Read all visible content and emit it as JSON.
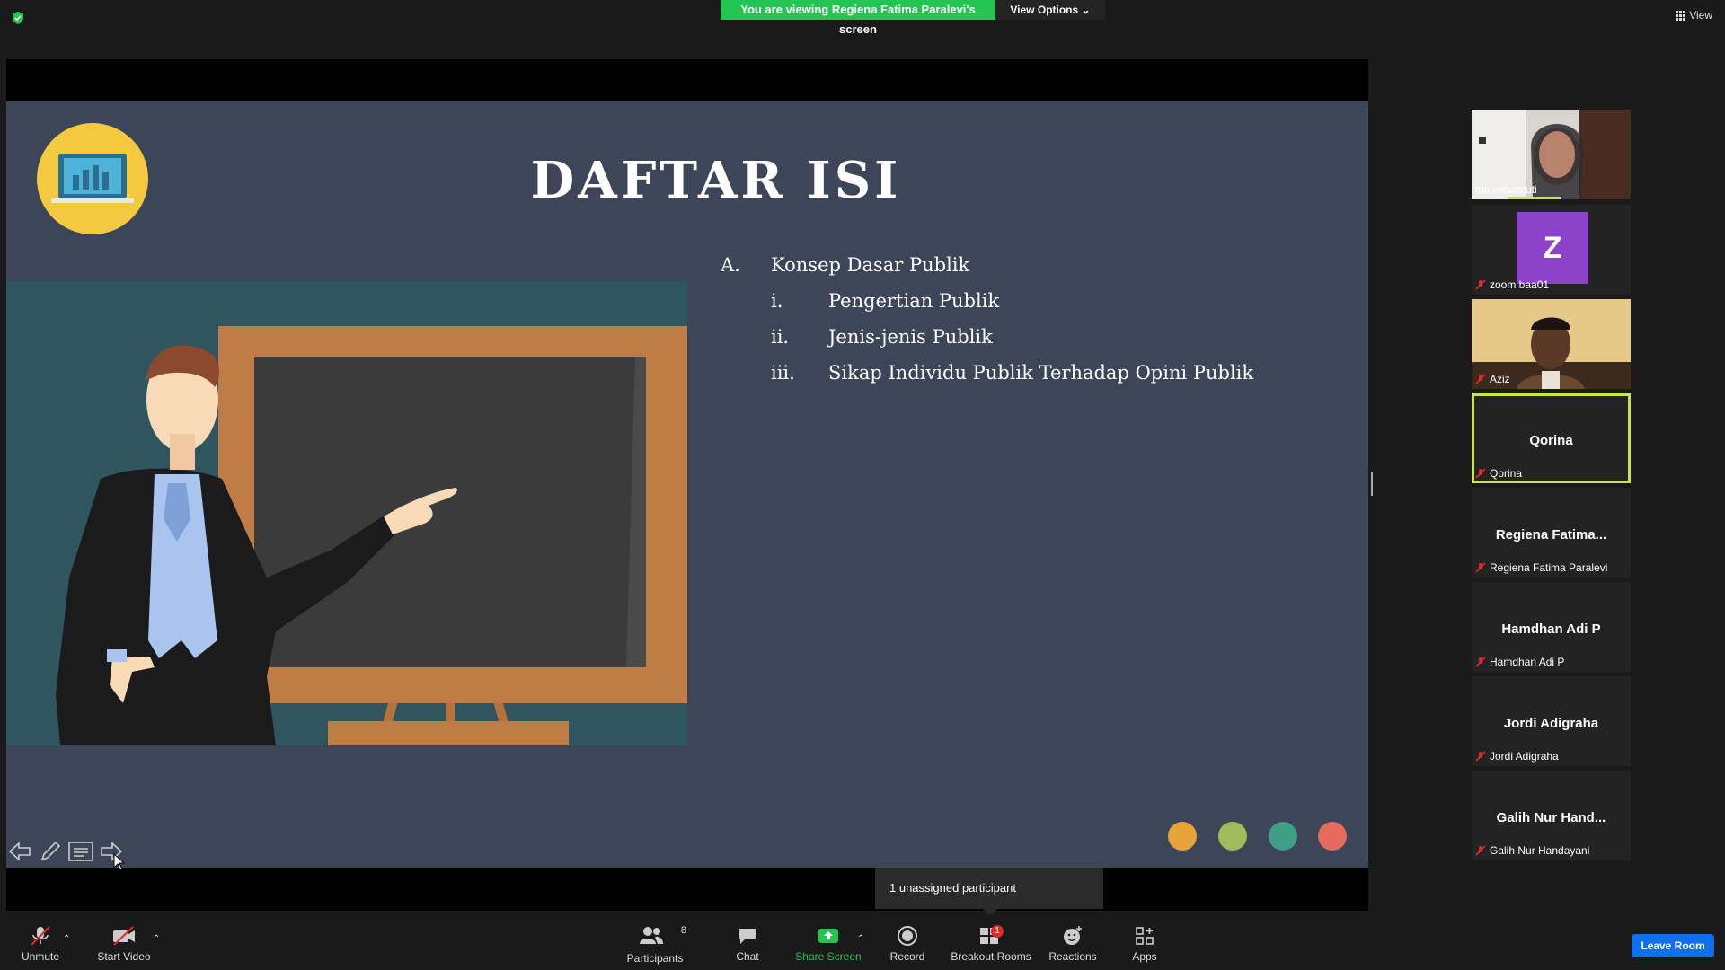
{
  "top_bar": {
    "viewing_banner": "You are viewing Regiena Fatima Paralevi's screen",
    "view_options": "View Options",
    "view_button": "View"
  },
  "slide": {
    "title": "DAFTAR ISI",
    "section": {
      "marker": "A.",
      "text": "Konsep Dasar Publik"
    },
    "items": [
      {
        "marker": "i.",
        "text": "Pengertian Publik"
      },
      {
        "marker": "ii.",
        "text": "Jenis-jenis Publik"
      },
      {
        "marker": "iii.",
        "text": "Sikap Individu Publik Terhadap Opini Publik"
      }
    ],
    "dot_colors": [
      "#e8a23b",
      "#9fbc5a",
      "#3f9e85",
      "#e46b5e"
    ]
  },
  "tooltip": "1 unassigned participant",
  "participants": [
    {
      "name": "tuti widiastuti",
      "display": "",
      "video": true,
      "muted": false
    },
    {
      "name": "zoom baa01",
      "display": "Z",
      "video": false,
      "muted": true
    },
    {
      "name": "Aziz",
      "display": "",
      "video": true,
      "muted": true
    },
    {
      "name": "Qorina",
      "display": "Qorina",
      "video": false,
      "muted": true,
      "active_speaker": true
    },
    {
      "name": "Regiena Fatima Paralevi",
      "display": "Regiena Fatima...",
      "video": false,
      "muted": true
    },
    {
      "name": "Hamdhan Adi P",
      "display": "Hamdhan Adi P",
      "video": false,
      "muted": true
    },
    {
      "name": "Jordi Adigraha",
      "display": "Jordi Adigraha",
      "video": false,
      "muted": true
    },
    {
      "name": "Galih Nur Handayani",
      "display": "Galih Nur Hand...",
      "video": false,
      "muted": true
    }
  ],
  "toolbar": {
    "unmute": "Unmute",
    "start_video": "Start Video",
    "participants": "Participants",
    "participants_count": "8",
    "chat": "Chat",
    "share_screen": "Share Screen",
    "record": "Record",
    "breakout_rooms": "Breakout Rooms",
    "breakout_badge": "1",
    "reactions": "Reactions",
    "apps": "Apps",
    "leave_room": "Leave Room"
  },
  "colors": {
    "banner_green": "#23c552",
    "slide_bg": "#3d4659",
    "active_speaker_border": "#c8e64a",
    "leave_blue": "#0e71eb",
    "zoom_avatar": "#8c43c9"
  }
}
